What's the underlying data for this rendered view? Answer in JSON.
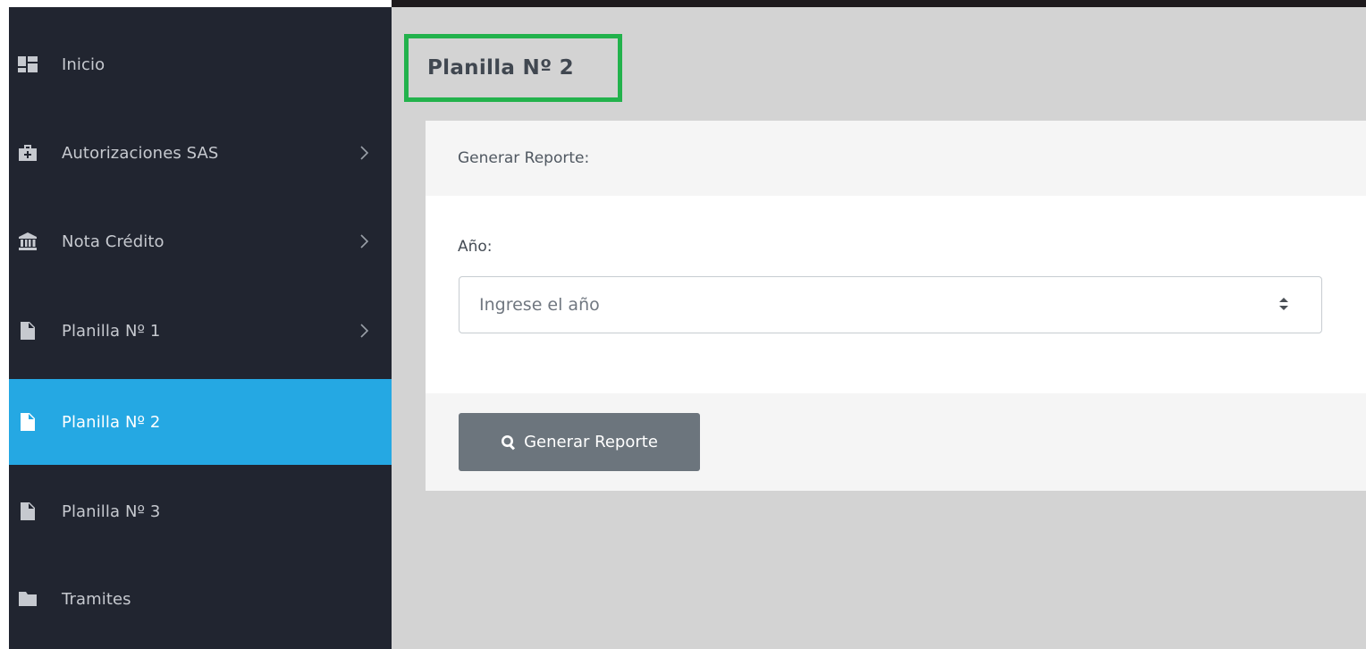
{
  "sidebar": {
    "items": [
      {
        "label": "Inicio",
        "icon": "dashboard-icon",
        "has_submenu": false,
        "active": false
      },
      {
        "label": "Autorizaciones SAS",
        "icon": "medkit-icon",
        "has_submenu": true,
        "active": false
      },
      {
        "label": "Nota Crédito",
        "icon": "bank-icon",
        "has_submenu": true,
        "active": false
      },
      {
        "label": "Planilla Nº 1",
        "icon": "file-icon",
        "has_submenu": true,
        "active": false
      },
      {
        "label": "Planilla Nº 2",
        "icon": "file-icon",
        "has_submenu": false,
        "active": true
      },
      {
        "label": "Planilla Nº 3",
        "icon": "file-icon",
        "has_submenu": false,
        "active": false
      },
      {
        "label": "Tramites",
        "icon": "folder-icon",
        "has_submenu": false,
        "active": false
      }
    ]
  },
  "main": {
    "page_title": "Planilla Nº 2",
    "card": {
      "header": "Generar Reporte:",
      "year_label": "Año:",
      "year_placeholder": "Ingrese el año",
      "year_value": "",
      "button_label": "Generar Reporte"
    }
  },
  "colors": {
    "sidebar_bg": "#212530",
    "active_bg": "#25a8e3",
    "main_bg": "#d3d3d3",
    "title_highlight": "#22b24c",
    "button_bg": "#6c757d"
  }
}
